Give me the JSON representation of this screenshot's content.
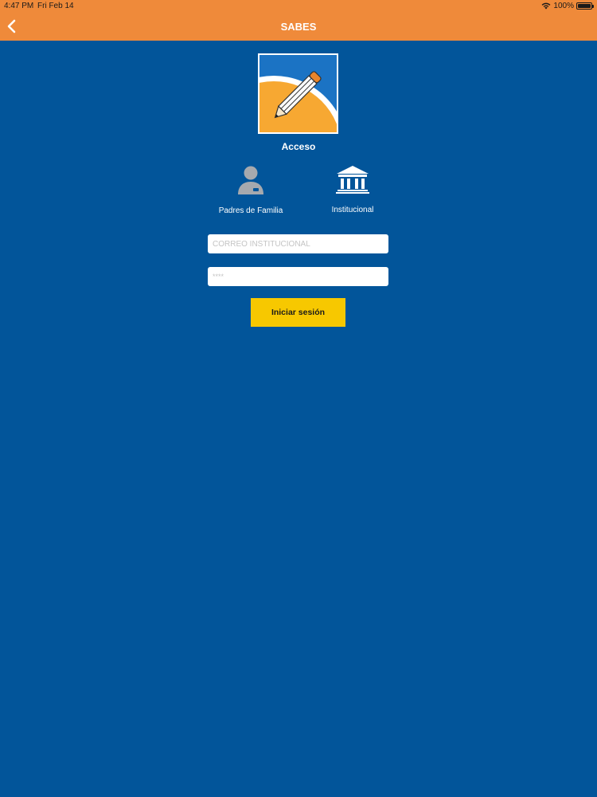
{
  "status_bar": {
    "time": "4:47 PM",
    "date": "Fri Feb 14",
    "battery": "100%"
  },
  "nav": {
    "title": "SABES"
  },
  "logo": {
    "name": "pencil-logo",
    "colors": {
      "blue": "#1B73C4",
      "orange": "#F7A832",
      "white": "#FFFFFF"
    }
  },
  "access": {
    "heading": "Acceso"
  },
  "roles": [
    {
      "label": "Padres de Familia",
      "icon": "person-icon"
    },
    {
      "label": "Institucional",
      "icon": "institution-icon"
    }
  ],
  "form": {
    "email_placeholder": "CORREO INSTITUCIONAL",
    "password_placeholder": "****",
    "submit_label": "Iniciar sesión"
  },
  "colors": {
    "background": "#02559A",
    "nav": "#EF8A3A",
    "button": "#F7C800"
  }
}
